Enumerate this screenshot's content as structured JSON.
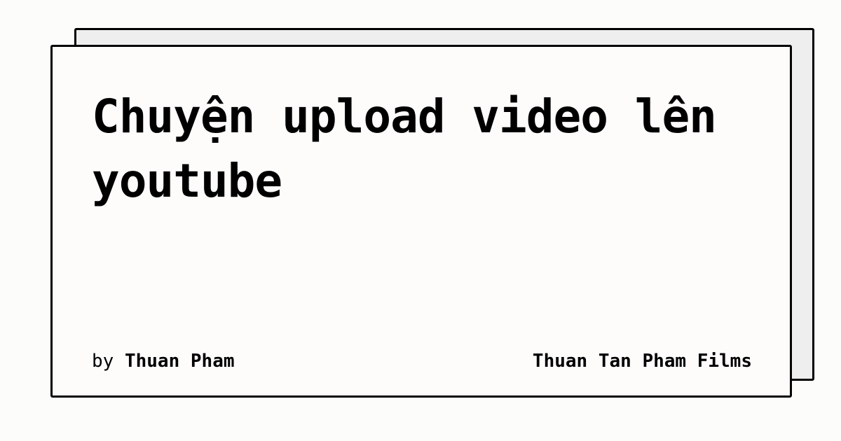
{
  "card": {
    "title": "Chuyện upload video lên youtube",
    "by_label": "by",
    "author": "Thuan Pham",
    "site_name": "Thuan Tan Pham Films"
  },
  "colors": {
    "background": "#fcfcfa",
    "card_front": "#fdfcfb",
    "card_back": "#eeeeee",
    "border": "#000000",
    "text": "#000000"
  }
}
